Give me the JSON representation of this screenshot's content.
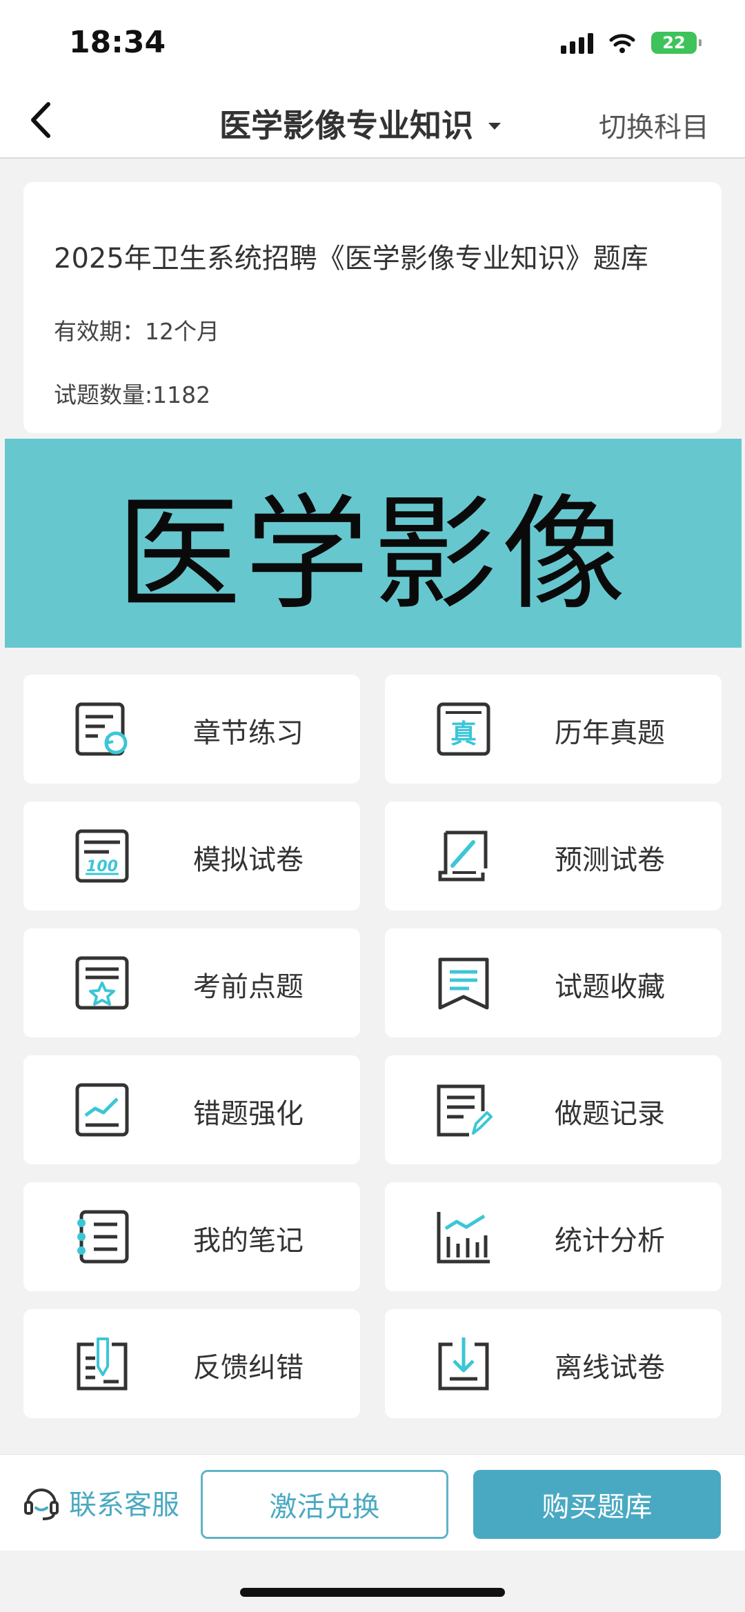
{
  "status_bar": {
    "time": "18:34",
    "battery": "22"
  },
  "nav": {
    "title": "医学影像专业知识",
    "action": "切换科目"
  },
  "info": {
    "title": "2025年卫生系统招聘《医学影像专业知识》题库",
    "validity": "有效期：12个月",
    "count": "试题数量:1182"
  },
  "banner": {
    "text": "医学影像"
  },
  "menu": [
    {
      "label": "章节练习",
      "icon": "chapter-practice-icon"
    },
    {
      "label": "历年真题",
      "icon": "past-exams-icon"
    },
    {
      "label": "模拟试卷",
      "icon": "mock-exam-icon"
    },
    {
      "label": "预测试卷",
      "icon": "predict-exam-icon"
    },
    {
      "label": "考前点题",
      "icon": "pre-exam-tips-icon"
    },
    {
      "label": "试题收藏",
      "icon": "favorites-icon"
    },
    {
      "label": "错题强化",
      "icon": "mistake-review-icon"
    },
    {
      "label": "做题记录",
      "icon": "practice-record-icon"
    },
    {
      "label": "我的笔记",
      "icon": "notes-icon"
    },
    {
      "label": "统计分析",
      "icon": "statistics-icon"
    },
    {
      "label": "反馈纠错",
      "icon": "feedback-icon"
    },
    {
      "label": "离线试卷",
      "icon": "offline-exam-icon"
    }
  ],
  "bottom": {
    "contact_label": "联系客服",
    "activate_label": "激活兑换",
    "buy_label": "购买题库"
  },
  "colors": {
    "accent": "#4aa9c2",
    "banner": "#67c7cf",
    "icon_stroke": "#333333",
    "icon_accent": "#3cc6d6"
  }
}
